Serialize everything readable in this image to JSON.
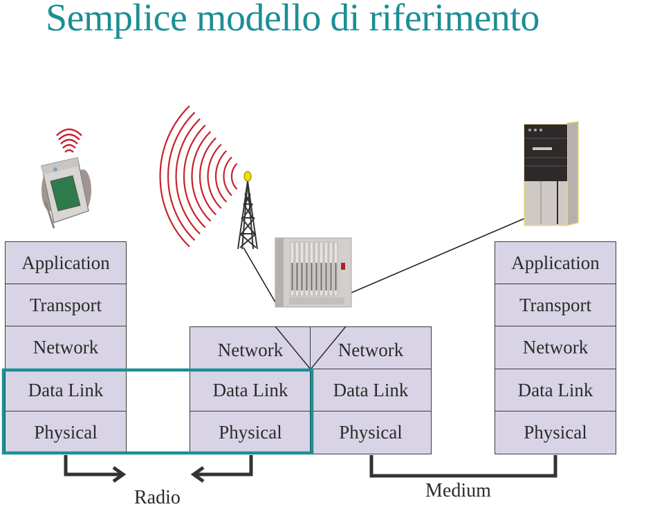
{
  "title": "Semplice modello di riferimento",
  "colors": {
    "title": "#1a8f95",
    "layer_fill": "#d9d4e5",
    "layer_border": "#3a3a3a",
    "highlight": "#1a8f95",
    "waves": "#c8202a",
    "tower": "#333333"
  },
  "devices": {
    "handheld": {
      "icon": "pda-icon",
      "signal": "wireless-signal-icon"
    },
    "tower": {
      "icon": "radio-tower-icon",
      "signal": "radio-waves-icon"
    },
    "router": {
      "icon": "router-rack-icon"
    },
    "server": {
      "icon": "server-tower-icon"
    }
  },
  "stacks": {
    "left": [
      "Application",
      "Transport",
      "Network",
      "Data Link",
      "Physical"
    ],
    "middle_left": [
      "Network",
      "Data Link",
      "Physical"
    ],
    "middle_right": [
      "Network",
      "Data Link",
      "Physical"
    ],
    "right": [
      "Application",
      "Transport",
      "Network",
      "Data Link",
      "Physical"
    ]
  },
  "links": {
    "radio": "Radio",
    "medium": "Medium"
  }
}
